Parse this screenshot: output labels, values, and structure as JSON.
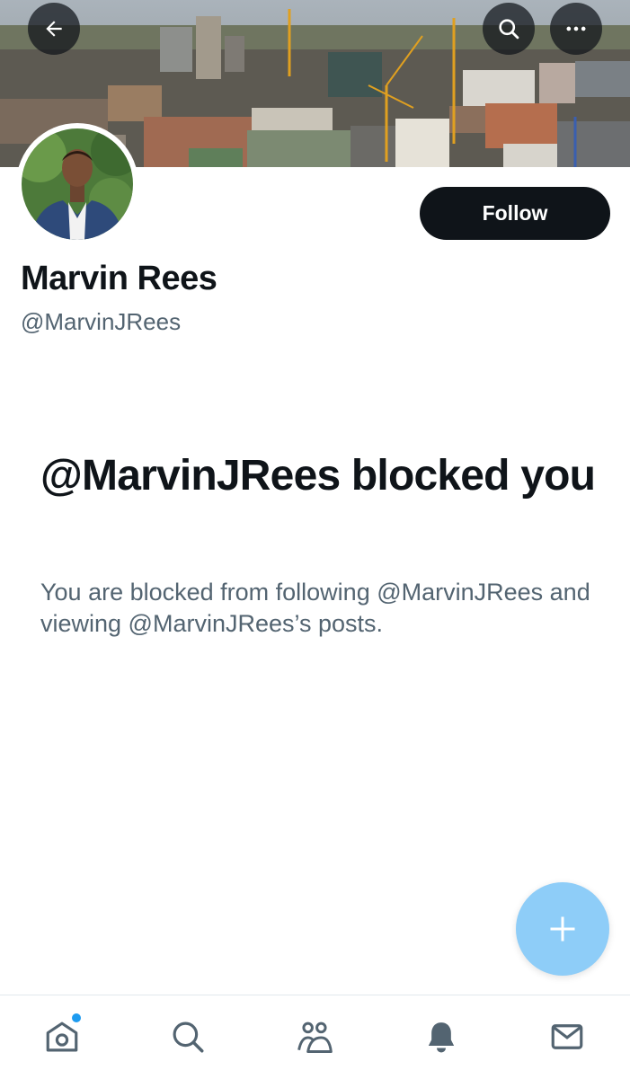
{
  "header": {
    "back_icon": "arrow-left-icon",
    "search_icon": "search-icon",
    "more_icon": "more-horizontal-icon"
  },
  "profile": {
    "display_name": "Marvin Rees",
    "handle": "@MarvinJRees",
    "follow_label": "Follow",
    "avatar": "profile-photo"
  },
  "blocked": {
    "title": "@MarvinJRees blocked you",
    "description": "You are blocked from following @MarvinJRees and viewing @MarvinJRees’s posts."
  },
  "fab": {
    "icon": "plus-icon"
  },
  "bottom_nav": {
    "items": [
      "home-icon",
      "search-icon",
      "communities-icon",
      "notifications-icon",
      "messages-icon"
    ],
    "has_unread_dot": true
  },
  "colors": {
    "text_primary": "#0f1419",
    "text_secondary": "#536471",
    "fab": "#8ecdf8",
    "accent": "#1d9bf0"
  }
}
